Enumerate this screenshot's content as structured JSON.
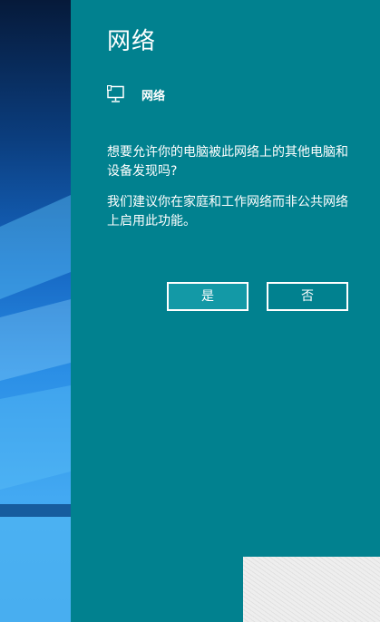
{
  "flyout": {
    "title": "网络",
    "network_icon": "wired-network-icon",
    "network_name": "网络",
    "question": "想要允许你的电脑被此网络上的其他电脑和设备发现吗?",
    "recommendation": "我们建议你在家庭和工作网络而非公共网络上启用此功能。",
    "yes_label": "是",
    "no_label": "否"
  },
  "colors": {
    "panel_background": "#01818f",
    "primary_button": "#1399a6",
    "text": "#ffffff"
  }
}
